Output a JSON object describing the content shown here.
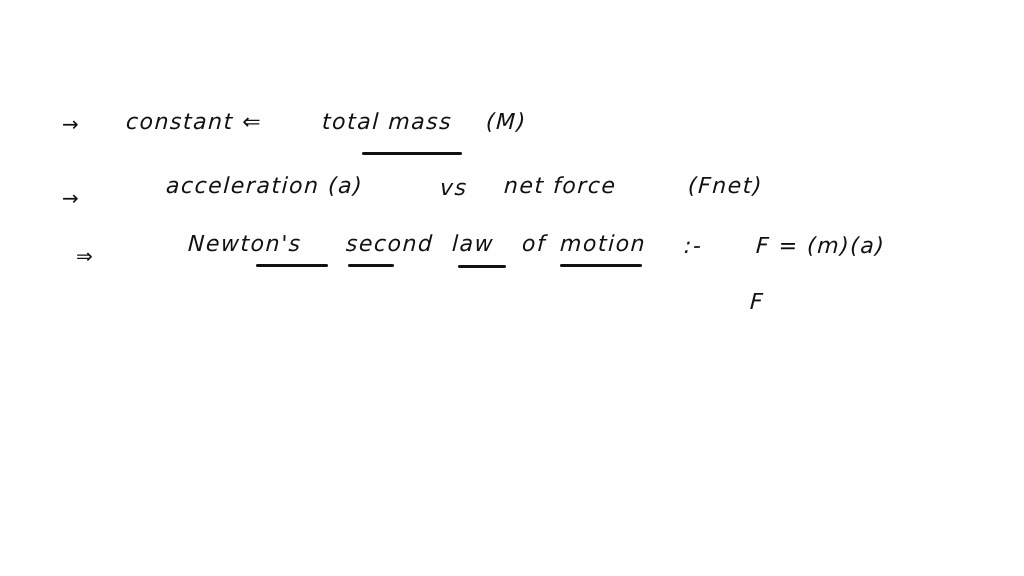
{
  "lines": [
    {
      "bullet": "→",
      "segments": {
        "a": "constant ⇐",
        "b": "total mass",
        "c": "(M)"
      }
    },
    {
      "bullet": "→",
      "segments": {
        "a": "acceleration (a)",
        "b": "vs",
        "c": "net force",
        "d": "(Fnet)"
      }
    },
    {
      "bullet": "⇒",
      "segments": {
        "a": "Newton's",
        "b": "second",
        "c": "law",
        "d": "of",
        "e": "motion",
        "f": ":-"
      }
    }
  ],
  "equation": {
    "text": "F = (m)(a)",
    "partial": "F"
  },
  "ink_color": "#111111",
  "background": "#fefefe"
}
